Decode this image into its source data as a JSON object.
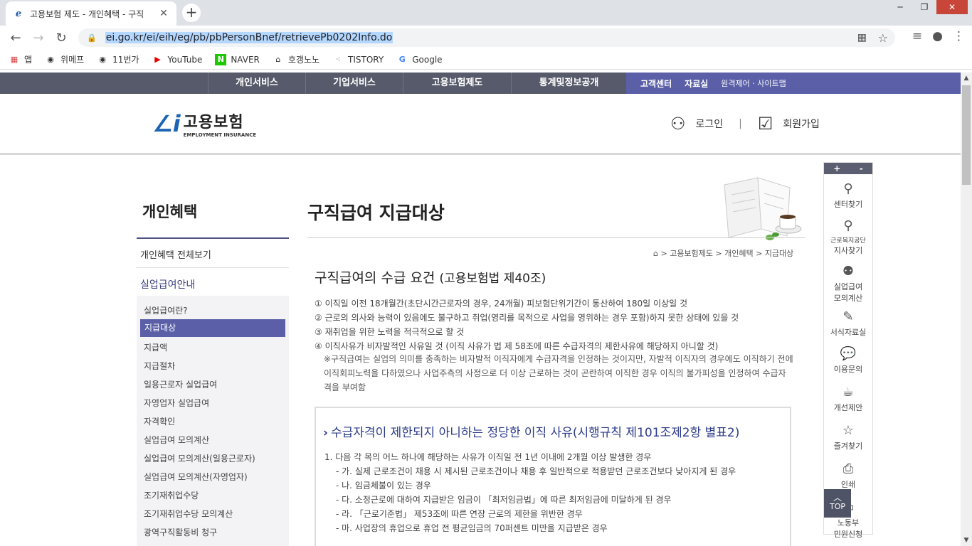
{
  "browser": {
    "tab_title": "고용보험 제도 - 개인혜택 - 구직",
    "url": "ei.go.kr/ei/eih/eg/pb/pbPersonBnef/retrievePb0202Info.do",
    "bookmarks": [
      "앱",
      "위메프",
      "11번가",
      "YouTube",
      "NAVER",
      "호갱노노",
      "TISTORY",
      "Google"
    ]
  },
  "gnb": {
    "menu": [
      "개인서비스",
      "기업서비스",
      "고용보험제도",
      "통계및정보공개"
    ],
    "util": [
      "고객센터",
      "자료실",
      "원격제어 · 사이트맵"
    ]
  },
  "header": {
    "logo_kr": "고용보험",
    "logo_en": "EMPLOYMENT INSURANCE",
    "login": "로그인",
    "signup": "회원가입"
  },
  "lnb": {
    "title": "개인혜택",
    "all": "개인혜택 전체보기",
    "section": "실업급여안내",
    "items": [
      "실업급여란?",
      "지급대상",
      "지급액",
      "지급절차",
      "일용근로자 실업급여",
      "자영업자 실업급여",
      "자격확인",
      "실업급여 모의계산",
      "실업급여 모의계산(일용근로자)",
      "실업급여 모의계산(자영업자)",
      "조기재취업수당",
      "조기재취업수당 모의계산",
      "광역구직활동비 청구"
    ],
    "active_index": 1
  },
  "main": {
    "title": "구직급여 지급대상",
    "breadcrumb": "> 고용보험제도 > 개인혜택 > 지급대상",
    "h2": "구직급여의 수급 요건",
    "h2_law": "(고용보험법 제40조)",
    "requirements": [
      "① 이직일 이전 18개월간(초단시간근로자의 경우, 24개월) 피보험단위기간이 통산하여 180일 이상일 것",
      "② 근로의 의사와 능력이 있음에도 불구하고 취업(영리를 목적으로 사업을 영위하는 경우 포함)하지 못한 상태에 있을 것",
      "③ 재취업을 위한 노력을 적극적으로 할 것",
      "④ 이직사유가 비자발적인 사유일 것 (이직 사유가 법 제 58조에 따른 수급자격의 제한사유에 해당하지 아니할 것)"
    ],
    "note": "※구직급여는 실업의 의미를 충족하는 비자발적 이직자에게 수급자격을 인정하는 것이지만, 자발적 이직자의 경우에도 이직하기 전에 이직회피노력을 다하였으나 사업주측의 사정으로 더 이상 근로하는 것이 곤란하여 이직한 경우 이직의 불가피성을 인정하여 수급자격을 부여함",
    "box_title": "수급자격이 제한되지 아니하는 정당한 이직 사유(시행규칙 제101조제2항 별표2)",
    "box_items": [
      "1. 다음 각 목의 어느 하나에 해당하는 사유가 이직일 전 1년 이내에 2개월 이상 발생한 경우",
      "- 가. 실제 근로조건이 채용 시 제시된 근로조건이나 채용 후 일반적으로 적용받던 근로조건보다 낮아지게 된 경우",
      "- 나. 임금체불이 있는 경우",
      "- 다. 소정근로에 대하여 지급받은 임금이 「최저임금법」에 따른 최저임금에 미달하게 된 경우",
      "- 라. 「근로기준법」 제53조에 따른 연장 근로의 제한을 위반한 경우",
      "- 마. 사업장의 휴업으로 휴업 전 평균임금의 70퍼센트 미만을 지급받은 경우"
    ]
  },
  "quick": {
    "zoom_in": "+",
    "zoom_out": "-",
    "items": [
      "센터찾기",
      "근로복지공단",
      "지사찾기",
      "실업급여",
      "모의계산",
      "서식자료실",
      "이용문의",
      "개선제안",
      "즐겨찾기",
      "인쇄",
      "노동부",
      "민원신청"
    ],
    "top": "TOP"
  }
}
